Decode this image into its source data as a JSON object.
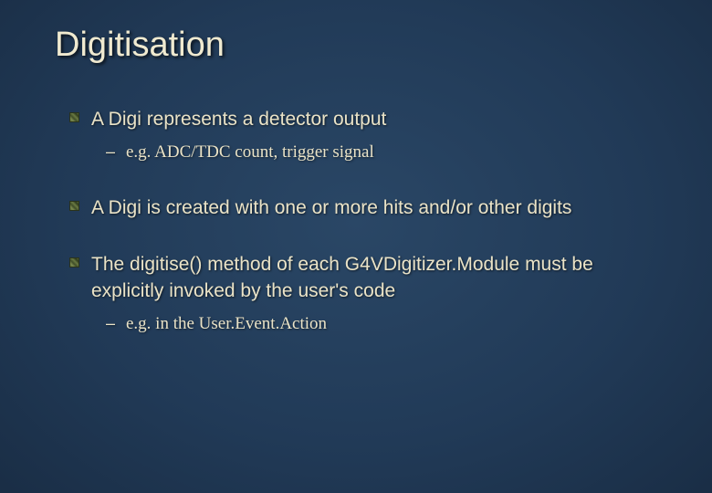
{
  "title": "Digitisation",
  "bullets": [
    {
      "text": "A Digi represents a detector output",
      "sub": [
        "e.g. ADC/TDC count, trigger signal"
      ]
    },
    {
      "text": "A Digi is created with one or more hits and/or other digits",
      "sub": []
    },
    {
      "text": "The digitise() method of each G4VDigitizer.Module must be explicitly invoked by the user's code",
      "sub": [
        "e.g. in the User.Event.Action"
      ]
    }
  ]
}
